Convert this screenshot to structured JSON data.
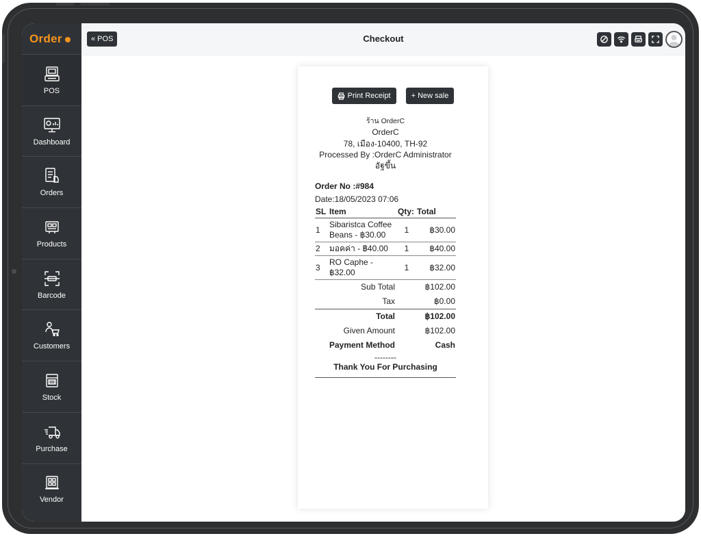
{
  "app": {
    "logo_text": "Order",
    "brand_color": "#f7941d",
    "sidebar_color": "#2f3337"
  },
  "sidebar": {
    "items": [
      {
        "label": "POS",
        "icon": "pos-terminal-icon",
        "active": true
      },
      {
        "label": "Dashboard",
        "icon": "dashboard-icon"
      },
      {
        "label": "Orders",
        "icon": "orders-icon"
      },
      {
        "label": "Products",
        "icon": "products-icon"
      },
      {
        "label": "Barcode",
        "icon": "barcode-scan-icon"
      },
      {
        "label": "Customers",
        "icon": "customers-icon"
      },
      {
        "label": "Stock",
        "icon": "stock-icon"
      },
      {
        "label": "Purchase",
        "icon": "purchase-truck-icon"
      },
      {
        "label": "Vendor",
        "icon": "vendor-icon"
      }
    ]
  },
  "header": {
    "back_label": "« POS",
    "title": "Checkout",
    "icons": [
      "sync-off-icon",
      "wifi-icon",
      "printer-icon",
      "fullscreen-icon",
      "user-avatar-icon"
    ]
  },
  "receipt": {
    "print_label": "Print Receipt",
    "new_sale_label": "+ New sale",
    "shop_name_thai": "ร้าน OrderC",
    "shop_name": "OrderC",
    "address": "78, เมือง-10400, TH-92",
    "processed_by": "Processed By :OrderC Administrator",
    "processed_sub": "อัฐขึ้น",
    "order_no": "Order No :#984",
    "date": "Date:18/05/2023 07:06",
    "columns": {
      "sl": "SL",
      "item": "Item",
      "qty": "Qty:",
      "total": "Total"
    },
    "items": [
      {
        "sl": "1",
        "name": "Sibaristca Coffee Beans - ฿30.00",
        "qty": "1",
        "total": "฿30.00"
      },
      {
        "sl": "2",
        "name": "มอคค่า - ฿40.00",
        "qty": "1",
        "total": "฿40.00"
      },
      {
        "sl": "3",
        "name": "RO Caphe - ฿32.00",
        "qty": "1",
        "total": "฿32.00"
      }
    ],
    "summary": {
      "sub_total_label": "Sub Total",
      "sub_total": "฿102.00",
      "tax_label": "Tax",
      "tax": "฿0.00",
      "total_label": "Total",
      "total": "฿102.00",
      "given_label": "Given Amount",
      "given": "฿102.00",
      "payment_label": "Payment Method",
      "payment": "Cash"
    },
    "divider": "--------",
    "thanks": "Thank You For Purchasing"
  }
}
